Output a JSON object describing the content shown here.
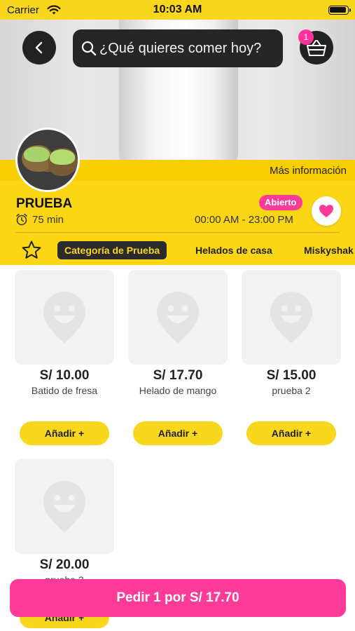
{
  "status_bar": {
    "carrier": "Carrier",
    "time": "10:03 AM"
  },
  "header": {
    "search_placeholder": "¿Qué quieres comer hoy?",
    "cart_count": "1",
    "icons": {
      "back": "chevron-left-icon",
      "search": "search-icon",
      "cart": "basket-icon"
    }
  },
  "store": {
    "more_info": "Más información",
    "name": "PRUEBA",
    "eta": "75 min",
    "status": "Abierto",
    "hours": "00:00 AM - 23:00 PM"
  },
  "tabs": [
    {
      "label": "Categoría de Prueba",
      "active": true
    },
    {
      "label": "Helados de casa",
      "active": false
    },
    {
      "label": "Miskyshak",
      "active": false
    }
  ],
  "products": [
    {
      "price": "S/ 10.00",
      "name": "Batido de fresa",
      "button": "Añadir +"
    },
    {
      "price": "S/ 17.70",
      "name": "Helado de mango",
      "button": "Añadir +"
    },
    {
      "price": "S/ 15.00",
      "name": "prueba 2",
      "button": "Añadir +"
    },
    {
      "price": "S/ 20.00",
      "name": "prueba 3",
      "button": "Añadir +"
    }
  ],
  "order_button": "Pedir 1 por S/ 17.70",
  "colors": {
    "accent_yellow": "#f9d71c",
    "accent_pink": "#ff3b9a",
    "dark": "#262626"
  }
}
